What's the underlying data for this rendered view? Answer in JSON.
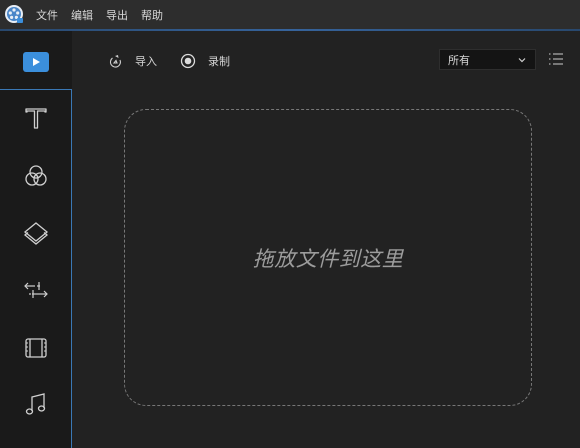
{
  "menu": {
    "items": [
      {
        "label": "文件"
      },
      {
        "label": "编辑"
      },
      {
        "label": "导出"
      },
      {
        "label": "帮助"
      }
    ]
  },
  "sidebar": {
    "items": [
      {
        "icon": "media-play-icon",
        "active": true
      },
      {
        "icon": "text-icon"
      },
      {
        "icon": "filter-circles-icon"
      },
      {
        "icon": "layers-overlay-icon"
      },
      {
        "icon": "transition-arrows-icon"
      },
      {
        "icon": "film-element-icon"
      },
      {
        "icon": "music-note-icon"
      }
    ]
  },
  "toolbar": {
    "import_label": "导入",
    "record_label": "录制",
    "filter_value": "所有"
  },
  "dropzone": {
    "hint": "拖放文件到这里"
  },
  "colors": {
    "accent": "#3b8fdc",
    "background": "#222222",
    "sidebar": "#1a1a1a",
    "menubar": "#2d2d2d"
  }
}
